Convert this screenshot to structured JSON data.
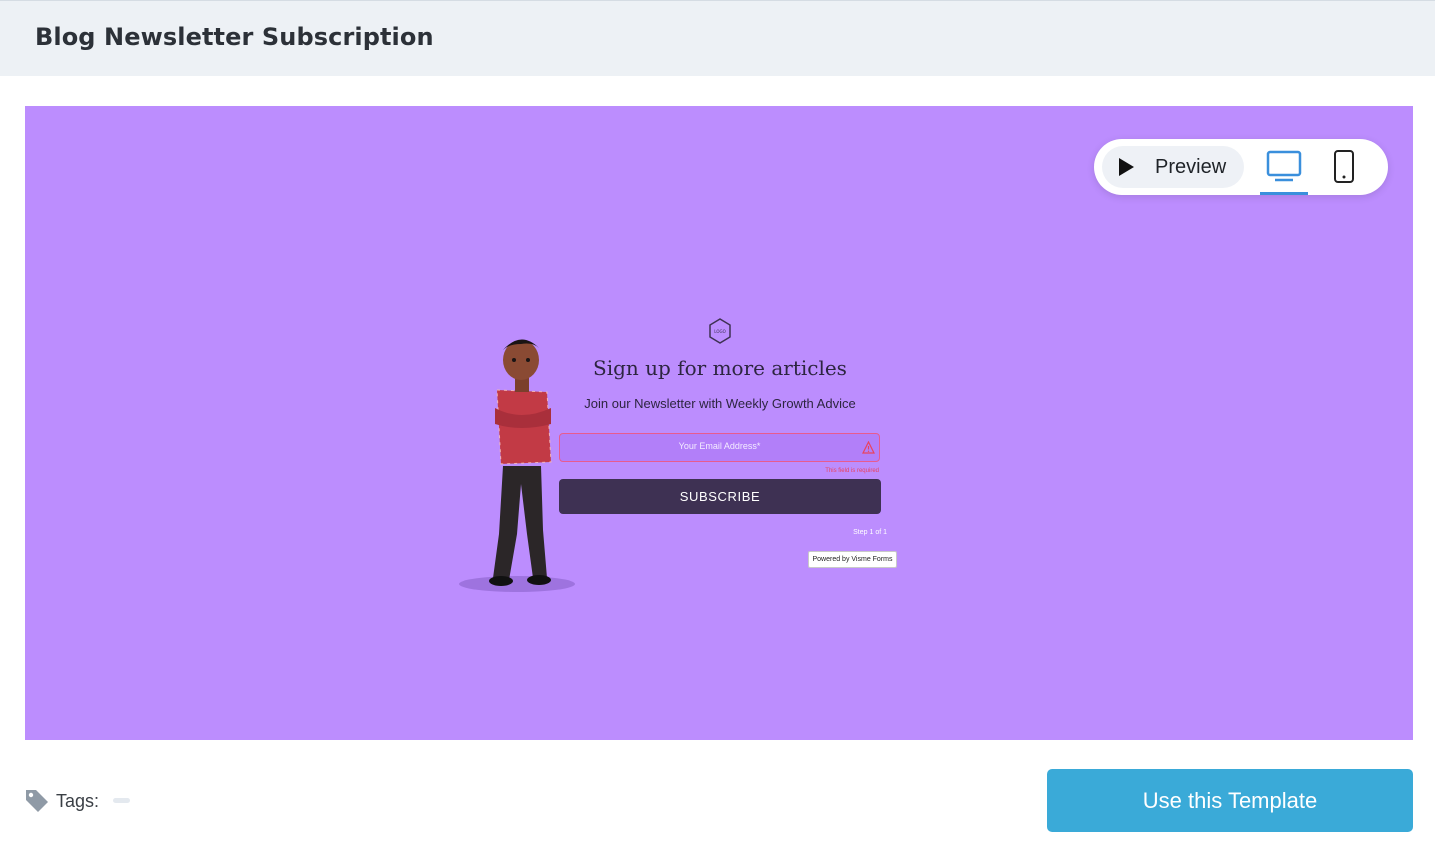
{
  "header": {
    "title": "Blog Newsletter Subscription"
  },
  "toolbar": {
    "preview_label": "Preview",
    "active_device": "desktop"
  },
  "form": {
    "logo_text": "LOGO",
    "title": "Sign up for more articles",
    "subtitle": "Join our Newsletter with Weekly Growth Advice",
    "email_placeholder": "Your Email Address*",
    "error_text": "This field is required",
    "subscribe_label": "SUBSCRIBE",
    "step_text": "Step 1 of 1",
    "powered_by": "Powered by Visme Forms"
  },
  "footer": {
    "tags_label": "Tags:",
    "use_template_label": "Use this Template"
  },
  "colors": {
    "canvas_bg": "#bc8dfe",
    "button_accent": "#3aaad8",
    "subscribe_bg": "#3e3153",
    "error": "#e8435f",
    "device_active": "#3a8fdc"
  }
}
